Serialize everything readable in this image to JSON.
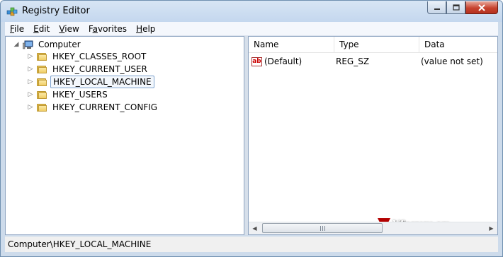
{
  "window": {
    "title": "Registry Editor",
    "buttons": {
      "minimize_icon": "minimize-icon",
      "maximize_icon": "maximize-icon",
      "close_icon": "close-icon"
    }
  },
  "menu": [
    {
      "label": "File",
      "accel": "F",
      "rest": "ile"
    },
    {
      "label": "Edit",
      "accel": "E",
      "rest": "dit"
    },
    {
      "label": "View",
      "accel": "V",
      "rest": "iew"
    },
    {
      "label": "Favorites",
      "accel": "a",
      "pre": "F",
      "rest": "vorites"
    },
    {
      "label": "Help",
      "accel": "H",
      "rest": "elp"
    }
  ],
  "tree": {
    "root": "Computer",
    "keys": [
      {
        "label": "HKEY_CLASSES_ROOT",
        "selected": false
      },
      {
        "label": "HKEY_CURRENT_USER",
        "selected": false
      },
      {
        "label": "HKEY_LOCAL_MACHINE",
        "selected": true
      },
      {
        "label": "HKEY_USERS",
        "selected": false
      },
      {
        "label": "HKEY_CURRENT_CONFIG",
        "selected": false
      }
    ]
  },
  "list": {
    "columns": [
      "Name",
      "Type",
      "Data"
    ],
    "rows": [
      {
        "name": "(Default)",
        "type": "REG_SZ",
        "data": "(value not set)",
        "icon": "string-value-icon"
      }
    ]
  },
  "watermark": "Vforum.vn",
  "status": "Computer\\HKEY_LOCAL_MACHINE",
  "colors": {
    "title_bg": "#c4d7ee",
    "close_button": "#c7432e",
    "selection_border": "#7da2ce",
    "folder": "#f0cd65"
  }
}
